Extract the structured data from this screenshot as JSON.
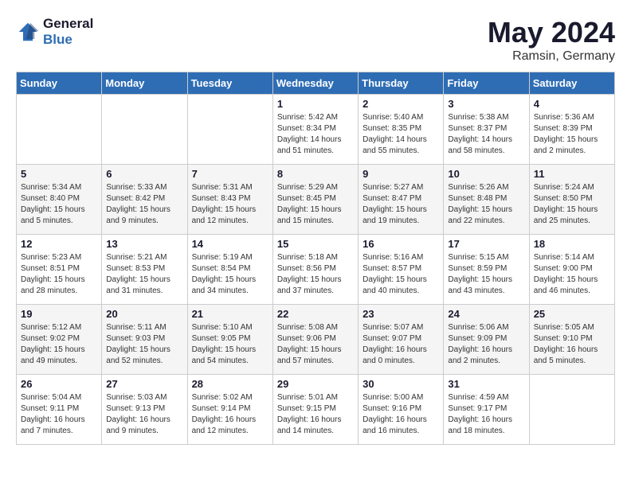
{
  "header": {
    "logo_line1": "General",
    "logo_line2": "Blue",
    "month": "May 2024",
    "location": "Ramsin, Germany"
  },
  "weekdays": [
    "Sunday",
    "Monday",
    "Tuesday",
    "Wednesday",
    "Thursday",
    "Friday",
    "Saturday"
  ],
  "weeks": [
    [
      {
        "day": "",
        "info": ""
      },
      {
        "day": "",
        "info": ""
      },
      {
        "day": "",
        "info": ""
      },
      {
        "day": "1",
        "info": "Sunrise: 5:42 AM\nSunset: 8:34 PM\nDaylight: 14 hours\nand 51 minutes."
      },
      {
        "day": "2",
        "info": "Sunrise: 5:40 AM\nSunset: 8:35 PM\nDaylight: 14 hours\nand 55 minutes."
      },
      {
        "day": "3",
        "info": "Sunrise: 5:38 AM\nSunset: 8:37 PM\nDaylight: 14 hours\nand 58 minutes."
      },
      {
        "day": "4",
        "info": "Sunrise: 5:36 AM\nSunset: 8:39 PM\nDaylight: 15 hours\nand 2 minutes."
      }
    ],
    [
      {
        "day": "5",
        "info": "Sunrise: 5:34 AM\nSunset: 8:40 PM\nDaylight: 15 hours\nand 5 minutes."
      },
      {
        "day": "6",
        "info": "Sunrise: 5:33 AM\nSunset: 8:42 PM\nDaylight: 15 hours\nand 9 minutes."
      },
      {
        "day": "7",
        "info": "Sunrise: 5:31 AM\nSunset: 8:43 PM\nDaylight: 15 hours\nand 12 minutes."
      },
      {
        "day": "8",
        "info": "Sunrise: 5:29 AM\nSunset: 8:45 PM\nDaylight: 15 hours\nand 15 minutes."
      },
      {
        "day": "9",
        "info": "Sunrise: 5:27 AM\nSunset: 8:47 PM\nDaylight: 15 hours\nand 19 minutes."
      },
      {
        "day": "10",
        "info": "Sunrise: 5:26 AM\nSunset: 8:48 PM\nDaylight: 15 hours\nand 22 minutes."
      },
      {
        "day": "11",
        "info": "Sunrise: 5:24 AM\nSunset: 8:50 PM\nDaylight: 15 hours\nand 25 minutes."
      }
    ],
    [
      {
        "day": "12",
        "info": "Sunrise: 5:23 AM\nSunset: 8:51 PM\nDaylight: 15 hours\nand 28 minutes."
      },
      {
        "day": "13",
        "info": "Sunrise: 5:21 AM\nSunset: 8:53 PM\nDaylight: 15 hours\nand 31 minutes."
      },
      {
        "day": "14",
        "info": "Sunrise: 5:19 AM\nSunset: 8:54 PM\nDaylight: 15 hours\nand 34 minutes."
      },
      {
        "day": "15",
        "info": "Sunrise: 5:18 AM\nSunset: 8:56 PM\nDaylight: 15 hours\nand 37 minutes."
      },
      {
        "day": "16",
        "info": "Sunrise: 5:16 AM\nSunset: 8:57 PM\nDaylight: 15 hours\nand 40 minutes."
      },
      {
        "day": "17",
        "info": "Sunrise: 5:15 AM\nSunset: 8:59 PM\nDaylight: 15 hours\nand 43 minutes."
      },
      {
        "day": "18",
        "info": "Sunrise: 5:14 AM\nSunset: 9:00 PM\nDaylight: 15 hours\nand 46 minutes."
      }
    ],
    [
      {
        "day": "19",
        "info": "Sunrise: 5:12 AM\nSunset: 9:02 PM\nDaylight: 15 hours\nand 49 minutes."
      },
      {
        "day": "20",
        "info": "Sunrise: 5:11 AM\nSunset: 9:03 PM\nDaylight: 15 hours\nand 52 minutes."
      },
      {
        "day": "21",
        "info": "Sunrise: 5:10 AM\nSunset: 9:05 PM\nDaylight: 15 hours\nand 54 minutes."
      },
      {
        "day": "22",
        "info": "Sunrise: 5:08 AM\nSunset: 9:06 PM\nDaylight: 15 hours\nand 57 minutes."
      },
      {
        "day": "23",
        "info": "Sunrise: 5:07 AM\nSunset: 9:07 PM\nDaylight: 16 hours\nand 0 minutes."
      },
      {
        "day": "24",
        "info": "Sunrise: 5:06 AM\nSunset: 9:09 PM\nDaylight: 16 hours\nand 2 minutes."
      },
      {
        "day": "25",
        "info": "Sunrise: 5:05 AM\nSunset: 9:10 PM\nDaylight: 16 hours\nand 5 minutes."
      }
    ],
    [
      {
        "day": "26",
        "info": "Sunrise: 5:04 AM\nSunset: 9:11 PM\nDaylight: 16 hours\nand 7 minutes."
      },
      {
        "day": "27",
        "info": "Sunrise: 5:03 AM\nSunset: 9:13 PM\nDaylight: 16 hours\nand 9 minutes."
      },
      {
        "day": "28",
        "info": "Sunrise: 5:02 AM\nSunset: 9:14 PM\nDaylight: 16 hours\nand 12 minutes."
      },
      {
        "day": "29",
        "info": "Sunrise: 5:01 AM\nSunset: 9:15 PM\nDaylight: 16 hours\nand 14 minutes."
      },
      {
        "day": "30",
        "info": "Sunrise: 5:00 AM\nSunset: 9:16 PM\nDaylight: 16 hours\nand 16 minutes."
      },
      {
        "day": "31",
        "info": "Sunrise: 4:59 AM\nSunset: 9:17 PM\nDaylight: 16 hours\nand 18 minutes."
      },
      {
        "day": "",
        "info": ""
      }
    ]
  ]
}
